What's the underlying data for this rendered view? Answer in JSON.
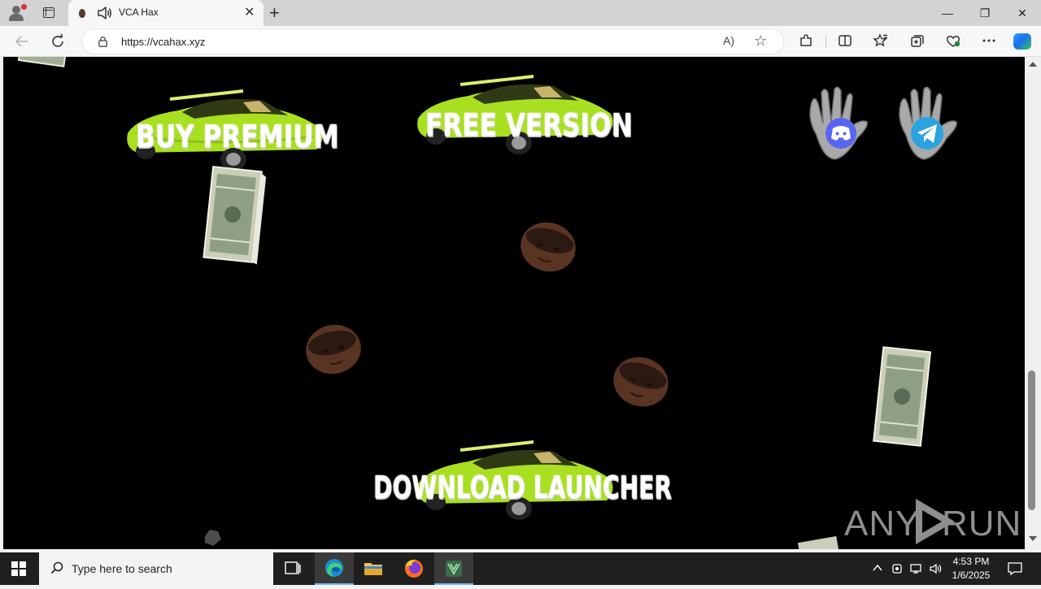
{
  "browser": {
    "tab_title": "VCA Hax",
    "tab_close": "✕",
    "new_tab": "+",
    "url": "https://vcahax.xyz",
    "read_aloud": "A)",
    "favorite_star": "☆",
    "window_controls": {
      "minimize": "—",
      "restore": "❐",
      "close": "✕"
    }
  },
  "page": {
    "buttons": {
      "buy_premium": "BUY PREMIUM",
      "free_version": "FREE VERSION",
      "download_launcher": "DOWNLOAD LAUNCHER"
    },
    "social": [
      "discord",
      "telegram"
    ],
    "watermark": {
      "left": "ANY",
      "right": "RUN"
    },
    "accent_car": "#a8e021",
    "background": "#000000"
  },
  "taskbar": {
    "search_placeholder": "Type here to search",
    "time": "4:53 PM",
    "date": "1/6/2025",
    "apps": [
      "task-view",
      "edge",
      "file-explorer",
      "firefox",
      "app-shield"
    ]
  }
}
